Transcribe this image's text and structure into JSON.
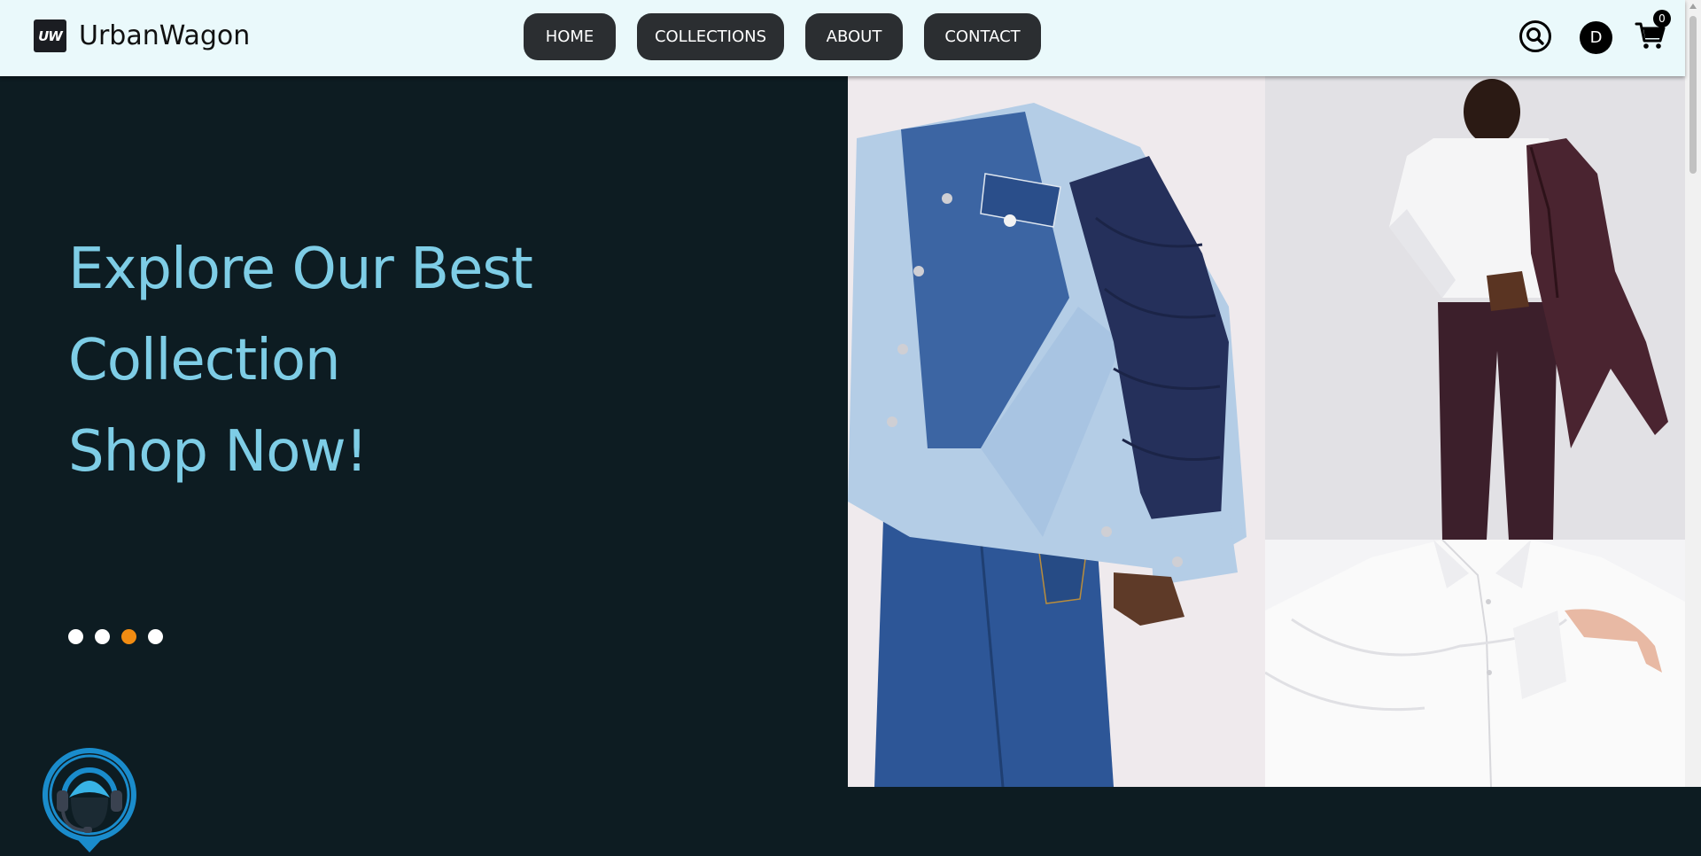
{
  "header": {
    "logo_text": "UW",
    "brand": "UrbanWagon",
    "nav": {
      "home": "HOME",
      "collections": "COLLECTIONS",
      "about": "ABOUT",
      "contact": "CONTACT"
    },
    "avatar_initial": "D",
    "cart_count": "0",
    "icons": [
      "search-icon",
      "cart-icon"
    ]
  },
  "hero": {
    "line1": "Explore Our Best",
    "line2": "Collection",
    "line3": "Shop Now!",
    "slides": 4,
    "active_slide": 3,
    "colors": {
      "accent_text": "#7ecde6",
      "active_dot": "#f28c12",
      "background": "#0d1c22"
    }
  },
  "images": [
    "denim-jacket-photo",
    "burgundy-suit-photo",
    "white-shirt-photo"
  ],
  "support": {
    "icon": "headset-support-icon"
  }
}
